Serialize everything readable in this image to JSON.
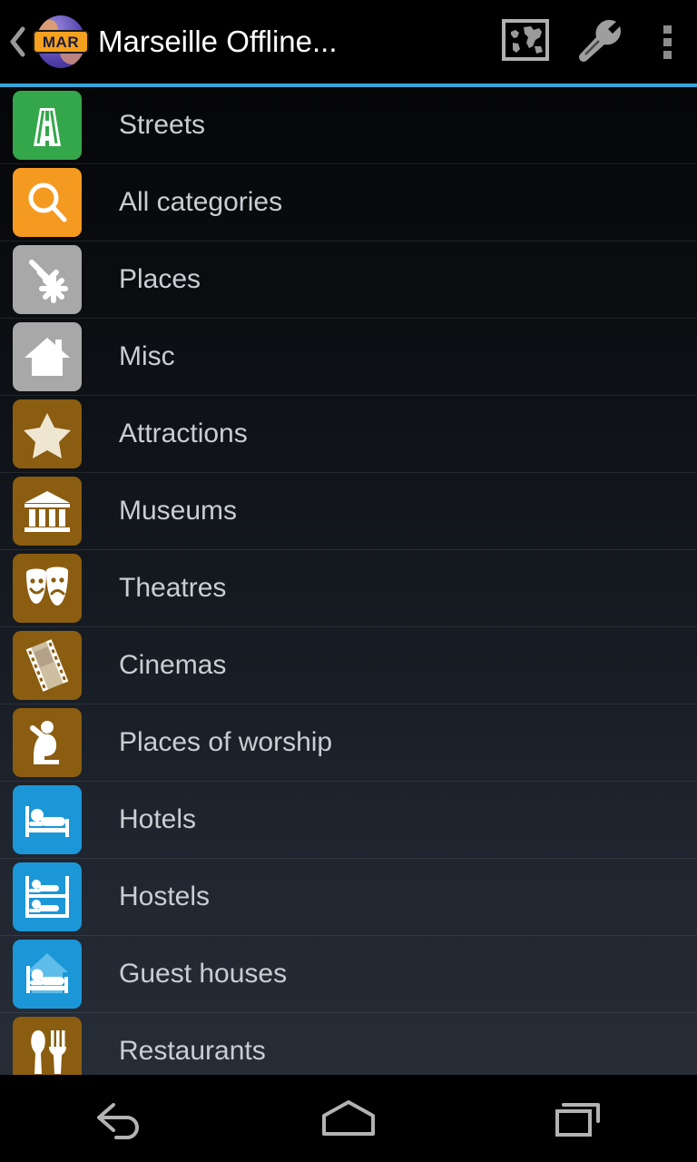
{
  "actionbar": {
    "back_icon": "chevron-left-icon",
    "app_icon": "globe-icon",
    "app_badge": "MAR",
    "title": "Marseille Offline...",
    "actions": [
      {
        "name": "world-map-icon",
        "label": "World map"
      },
      {
        "name": "wrench-icon",
        "label": "Tools"
      },
      {
        "name": "overflow-menu-icon",
        "label": "More options"
      }
    ]
  },
  "accent_color": "#36a5db",
  "colors": {
    "green": "#34a74b",
    "orange": "#f59a20",
    "gray": "#a8a8a8",
    "brown": "#8a5d10",
    "blue": "#1b97d8",
    "blue_light": "#58b9e8",
    "text": "#c9ced3",
    "title": "#ffffff",
    "background_top": "#050607",
    "background_bottom": "#262d37"
  },
  "list": {
    "items": [
      {
        "label": "Streets",
        "icon": "road-icon",
        "tile_color": "#34a74b"
      },
      {
        "label": "All categories",
        "icon": "search-icon",
        "tile_color": "#f59a20"
      },
      {
        "label": "Places",
        "icon": "waypoint-icon",
        "tile_color": "#a8a8a8"
      },
      {
        "label": "Misc",
        "icon": "house-icon",
        "tile_color": "#a8a8a8"
      },
      {
        "label": "Attractions",
        "icon": "star-icon",
        "tile_color": "#8a5d10"
      },
      {
        "label": "Museums",
        "icon": "museum-icon",
        "tile_color": "#8a5d10"
      },
      {
        "label": "Theatres",
        "icon": "masks-icon",
        "tile_color": "#8a5d10"
      },
      {
        "label": "Cinemas",
        "icon": "film-strip-icon",
        "tile_color": "#8a5d10"
      },
      {
        "label": "Places of worship",
        "icon": "praying-icon",
        "tile_color": "#8a5d10"
      },
      {
        "label": "Hotels",
        "icon": "bed-icon",
        "tile_color": "#1b97d8"
      },
      {
        "label": "Hostels",
        "icon": "bunk-bed-icon",
        "tile_color": "#1b97d8"
      },
      {
        "label": "Guest houses",
        "icon": "bed-house-icon",
        "tile_color": "#1b97d8"
      },
      {
        "label": "Restaurants",
        "icon": "cutlery-icon",
        "tile_color": "#8a5d10"
      }
    ]
  },
  "navbar": {
    "buttons": [
      {
        "name": "nav-back-button",
        "icon": "back-arrow-icon"
      },
      {
        "name": "nav-home-button",
        "icon": "home-icon"
      },
      {
        "name": "nav-recents-button",
        "icon": "recents-icon"
      }
    ]
  }
}
